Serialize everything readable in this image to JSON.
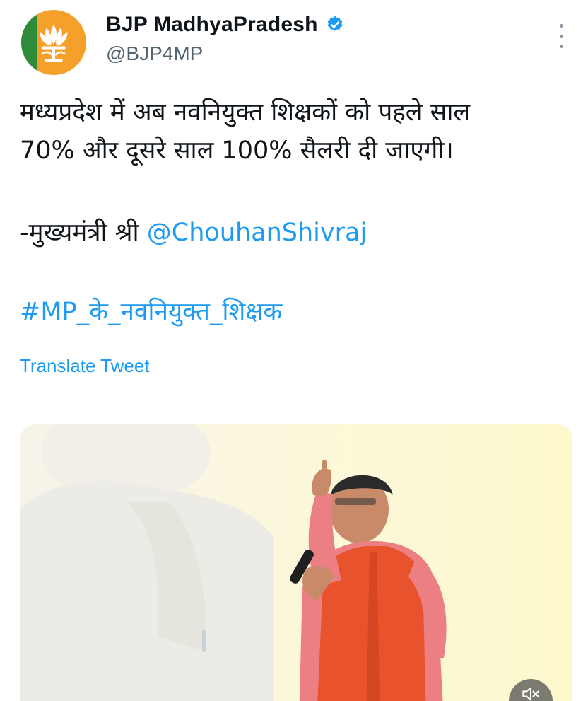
{
  "author": {
    "display_name": "BJP MadhyaPradesh",
    "handle": "@BJP4MP",
    "verified": true
  },
  "tweet": {
    "line1": "मध्यप्रदेश में अब नवनियुक्त शिक्षकों को पहले साल",
    "line2": "70% और दूसरे साल 100% सैलरी दी जाएगी।",
    "attribution_prefix": "-मुख्यमंत्री श्री ",
    "mention": "@ChouhanShivraj",
    "hashtag": "#MP_के_नवनियुक्त_शिक्षक"
  },
  "actions": {
    "translate_label": "Translate Tweet"
  },
  "icons": {
    "verified": "verified-badge-icon",
    "more": "more-vertical-icon",
    "mute": "speaker-muted-icon"
  },
  "colors": {
    "link": "#1d9bf0",
    "text": "#0f1419",
    "secondary": "#536471",
    "avatar_bg": "#f5a02a",
    "avatar_stripe": "#2e8b3a"
  }
}
